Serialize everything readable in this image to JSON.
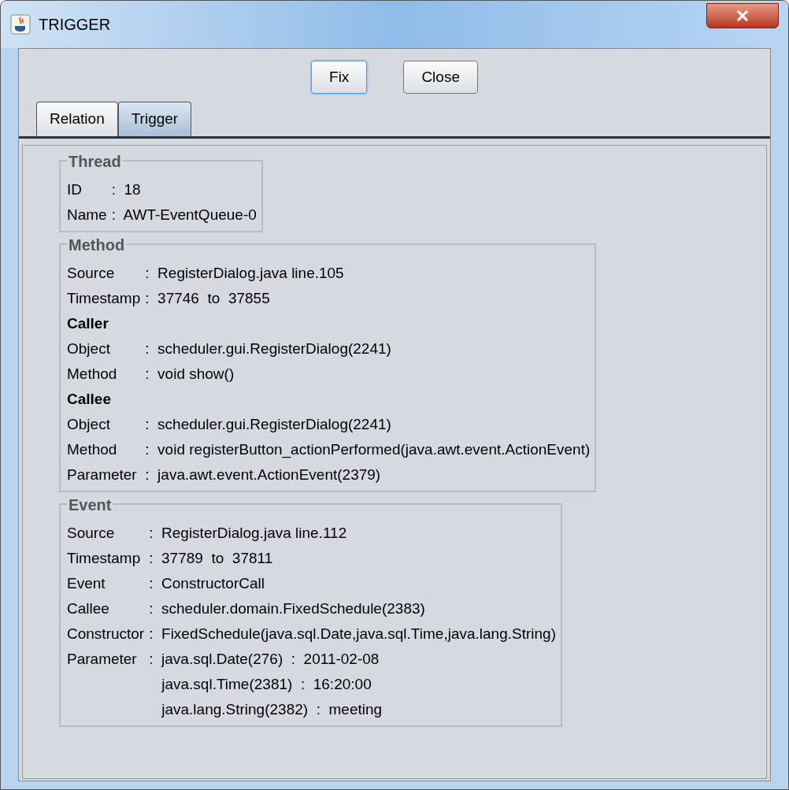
{
  "window": {
    "title": "TRIGGER"
  },
  "buttons": [
    {
      "label": "Fix",
      "focused": true
    },
    {
      "label": "Close",
      "focused": false
    }
  ],
  "tabs": [
    {
      "label": "Relation",
      "selected": false
    },
    {
      "label": "Trigger",
      "selected": true
    }
  ],
  "groups": [
    {
      "title": "Thread",
      "rows": [
        {
          "kind": "field",
          "label": "ID",
          "value": ":  18"
        },
        {
          "kind": "field",
          "label": "Name",
          "value": ":  AWT-EventQueue-0"
        }
      ]
    },
    {
      "title": "Method",
      "rows": [
        {
          "kind": "field",
          "label": "Source",
          "value": ":  RegisterDialog.java line.105"
        },
        {
          "kind": "field",
          "label": "Timestamp",
          "value": ":  37746  to  37855"
        },
        {
          "kind": "heading",
          "label": "Caller"
        },
        {
          "kind": "field",
          "label": "Object",
          "value": ":  scheduler.gui.RegisterDialog(2241)"
        },
        {
          "kind": "field",
          "label": "Method",
          "value": ":  void show()"
        },
        {
          "kind": "heading",
          "label": "Callee"
        },
        {
          "kind": "field",
          "label": "Object",
          "value": ":  scheduler.gui.RegisterDialog(2241)"
        },
        {
          "kind": "field",
          "label": "Method",
          "value": ":  void registerButton_actionPerformed(java.awt.event.ActionEvent)"
        },
        {
          "kind": "field",
          "label": "Parameter",
          "value": ":  java.awt.event.ActionEvent(2379)"
        }
      ]
    },
    {
      "title": "Event",
      "rows": [
        {
          "kind": "field",
          "label": "Source",
          "value": ":  RegisterDialog.java line.112"
        },
        {
          "kind": "field",
          "label": "Timestamp",
          "value": ":  37789  to  37811"
        },
        {
          "kind": "field",
          "label": "Event",
          "value": ":  ConstructorCall"
        },
        {
          "kind": "field",
          "label": "Callee",
          "value": ":  scheduler.domain.FixedSchedule(2383)"
        },
        {
          "kind": "field",
          "label": "Constructor",
          "value": ":  FixedSchedule(java.sql.Date,java.sql.Time,java.lang.String)"
        },
        {
          "kind": "field",
          "label": "Parameter",
          "value": ":  java.sql.Date(276)  :  2011-02-08"
        },
        {
          "kind": "continuation",
          "value": "java.sql.Time(2381)  :  16:20:00"
        },
        {
          "kind": "continuation",
          "value": "java.lang.String(2382)  :  meeting"
        }
      ]
    }
  ]
}
